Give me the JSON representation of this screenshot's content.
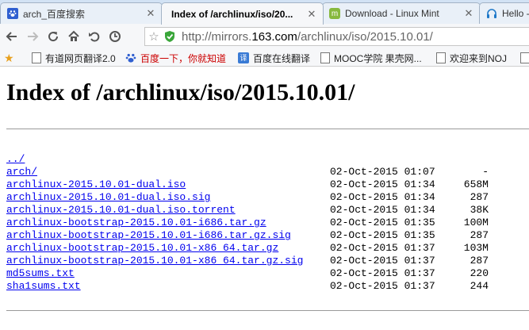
{
  "tabs": [
    {
      "title": "arch_百度搜索",
      "icon": "baidu-paw-icon",
      "active": false
    },
    {
      "title": "Index of /archlinux/iso/20...",
      "icon": "none",
      "active": true
    },
    {
      "title": "Download - Linux Mint",
      "icon": "linux-mint-icon",
      "active": false
    },
    {
      "title": "Hello -",
      "icon": "headphones-icon",
      "active": false
    }
  ],
  "address_bar": {
    "scheme": "http://mirrors.",
    "host": "163.com",
    "path": "/archlinux/iso/2015.10.01/"
  },
  "bookmarks": [
    {
      "label": "有道网页翻译2.0",
      "icon": "page-icon"
    },
    {
      "label": "百度一下，你就知道",
      "icon": "baidu-paw-icon"
    },
    {
      "label": "百度在线翻译",
      "icon": "baidu-translate-icon"
    },
    {
      "label": "MOOC学院 果壳网...",
      "icon": "page-icon"
    },
    {
      "label": "欢迎来到NOJ",
      "icon": "page-icon"
    }
  ],
  "page": {
    "heading": "Index of /archlinux/iso/2015.10.01/",
    "entries": [
      {
        "name": "../",
        "date": "",
        "size": ""
      },
      {
        "name": "arch/",
        "date": "02-Oct-2015 01:07",
        "size": "-"
      },
      {
        "name": "archlinux-2015.10.01-dual.iso",
        "date": "02-Oct-2015 01:34",
        "size": "658M"
      },
      {
        "name": "archlinux-2015.10.01-dual.iso.sig",
        "date": "02-Oct-2015 01:34",
        "size": "287"
      },
      {
        "name": "archlinux-2015.10.01-dual.iso.torrent",
        "date": "02-Oct-2015 01:34",
        "size": "38K"
      },
      {
        "name": "archlinux-bootstrap-2015.10.01-i686.tar.gz",
        "date": "02-Oct-2015 01:35",
        "size": "100M"
      },
      {
        "name": "archlinux-bootstrap-2015.10.01-i686.tar.gz.sig",
        "date": "02-Oct-2015 01:35",
        "size": "287"
      },
      {
        "name": "archlinux-bootstrap-2015.10.01-x86_64.tar.gz",
        "date": "02-Oct-2015 01:37",
        "size": "103M"
      },
      {
        "name": "archlinux-bootstrap-2015.10.01-x86_64.tar.gz.sig",
        "date": "02-Oct-2015 01:37",
        "size": "287"
      },
      {
        "name": "md5sums.txt",
        "date": "02-Oct-2015 01:37",
        "size": "220"
      },
      {
        "name": "sha1sums.txt",
        "date": "02-Oct-2015 01:37",
        "size": "244"
      }
    ]
  },
  "colors": {
    "link": "#0000ee",
    "secure_shield": "#3aa63a",
    "bookmark_star": "#e8a01e"
  }
}
